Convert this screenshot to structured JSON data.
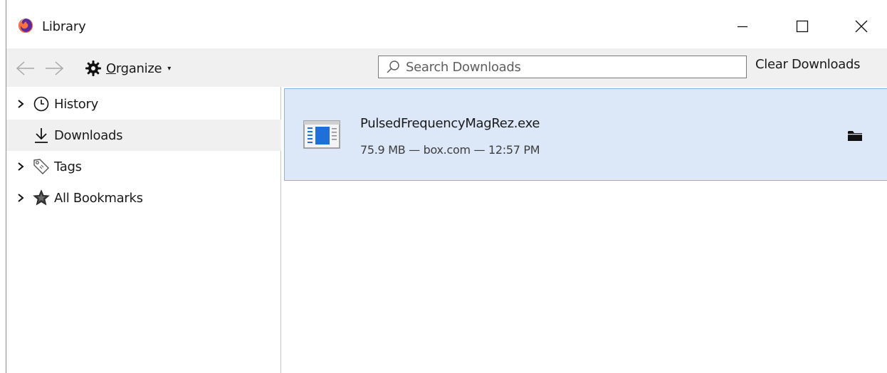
{
  "window": {
    "title": "Library",
    "controls": {
      "minimize": "minimize",
      "maximize": "maximize",
      "close": "close"
    }
  },
  "toolbar": {
    "organize_label_underlined": "O",
    "organize_label_rest": "rganize",
    "search_placeholder": "Search Downloads",
    "search_value": "",
    "clear_label": "Clear Downloads"
  },
  "sidebar": {
    "items": [
      {
        "label": "History",
        "icon": "clock-icon",
        "expandable": true,
        "selected": false
      },
      {
        "label": "Downloads",
        "icon": "download-icon",
        "expandable": false,
        "selected": true
      },
      {
        "label": "Tags",
        "icon": "tag-icon",
        "expandable": true,
        "selected": false
      },
      {
        "label": "All Bookmarks",
        "icon": "star-icon",
        "expandable": true,
        "selected": false
      }
    ]
  },
  "downloads": [
    {
      "filename": "PulsedFrequencyMagRez.exe",
      "meta": "75.9 MB — box.com — 12:57 PM",
      "icon": "executable-file-icon",
      "action_icon": "folder-icon"
    }
  ],
  "colors": {
    "selected_row_bg": "#dce8f8",
    "selected_row_border": "#8fb4e3",
    "toolbar_bg": "#f0f0f0",
    "file_icon_blue": "#1e6fd9"
  }
}
